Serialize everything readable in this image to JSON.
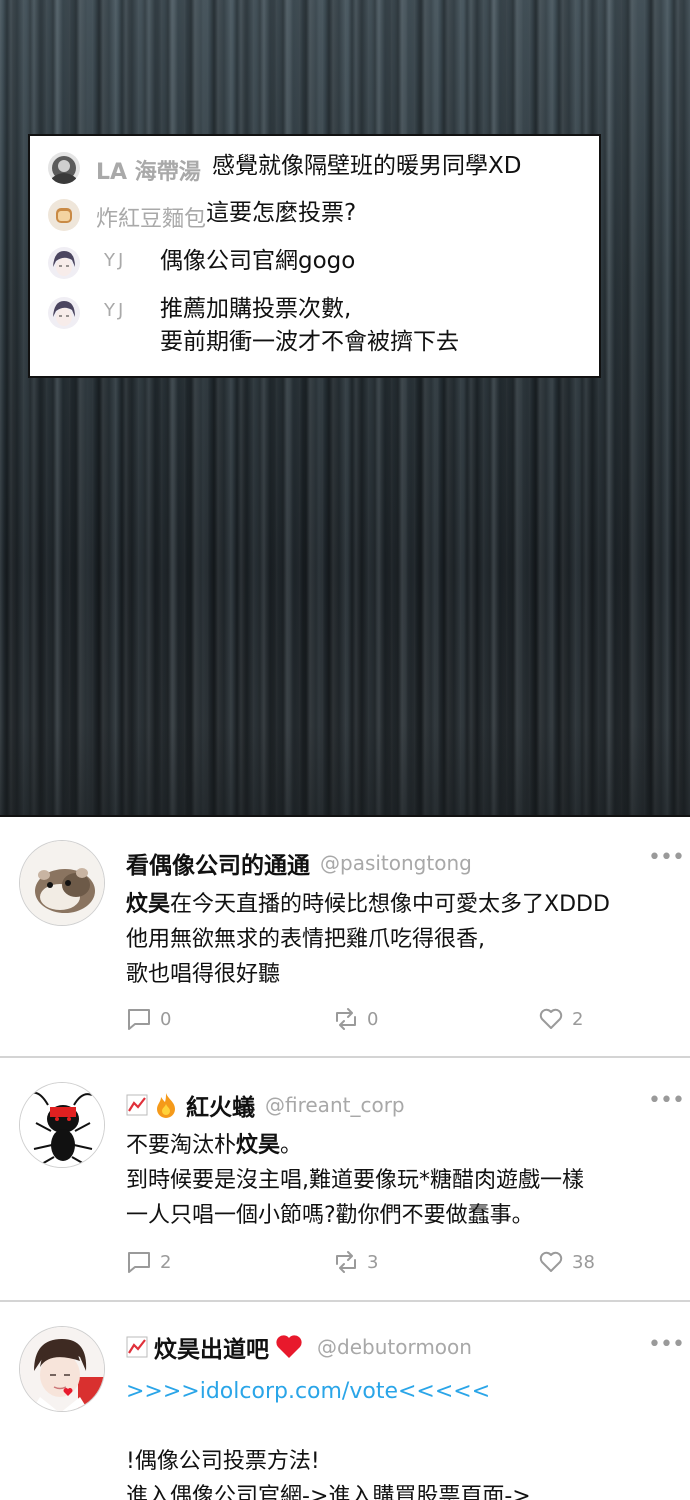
{
  "comments": [
    {
      "user": "LA 海帶湯",
      "text": "感覺就像隔壁班的暖男同學XD"
    },
    {
      "user": "炸紅豆麵包",
      "text": "這要怎麼投票?"
    },
    {
      "user": "YJ",
      "text": "偶像公司官網gogo"
    },
    {
      "user": "YJ",
      "lines": [
        "推薦加購投票次數,",
        "要前期衝一波才不會被擠下去"
      ]
    }
  ],
  "posts": [
    {
      "name": "看偶像公司的通通",
      "handle": "@pasitongtong",
      "more": "•••",
      "lines": [
        {
          "bold": "炆昊",
          "rest": "在今天直播的時候比想像中可愛太多了XDDD"
        },
        {
          "text": "他用無欲無求的表情把雞爪吃得很香,"
        },
        {
          "text": "歌也唱得很好聽"
        }
      ],
      "reply_count": "0",
      "retweet_count": "0",
      "like_count": "2"
    },
    {
      "name": "紅火蟻",
      "handle": "@fireant_corp",
      "more": "•••",
      "lines": [
        {
          "pre": "不要淘汰朴",
          "bold": "炆昊",
          "post": "。"
        },
        {
          "text": "到時候要是沒主唱,難道要像玩*糖醋肉遊戲一樣"
        },
        {
          "text": "一人只唱一個小節嗎?勸你們不要做蠢事。"
        }
      ],
      "reply_count": "2",
      "retweet_count": "3",
      "like_count": "38"
    },
    {
      "name": "炆昊出道吧",
      "handle": "@debutormoon",
      "more": "•••",
      "link": ">>>>idolcorp.com/vote<<<<<",
      "lines": [
        {
          "text": "!偶像公司投票方法!"
        },
        {
          "text": "進入偶像公司官網->進入購買股票頁面->"
        }
      ]
    }
  ],
  "colors": {
    "link": "#2aa5e8",
    "heart": "#e8192c",
    "fire": "#f59a1a",
    "meta_gray": "#9a9a9a"
  },
  "icons": [
    "reply-icon",
    "retweet-icon",
    "heart-outline-icon",
    "chart-emoji-icon",
    "fire-emoji-icon",
    "red-heart-emoji-icon",
    "more-icon"
  ]
}
